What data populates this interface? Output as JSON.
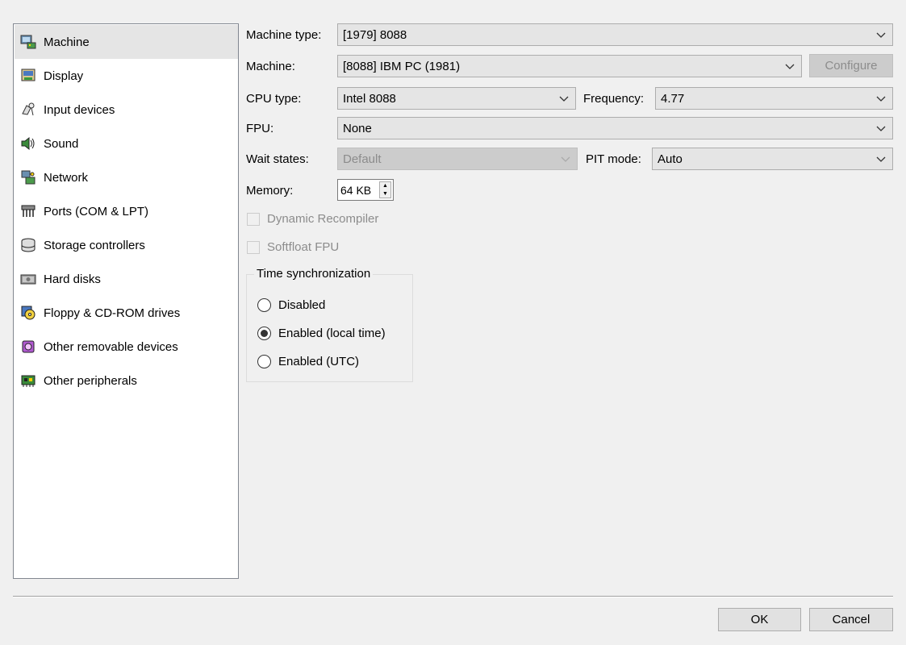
{
  "sidebar": {
    "selected_index": 0,
    "items": [
      {
        "label": "Machine",
        "icon": "machine-icon"
      },
      {
        "label": "Display",
        "icon": "display-icon"
      },
      {
        "label": "Input devices",
        "icon": "input-devices-icon"
      },
      {
        "label": "Sound",
        "icon": "sound-icon"
      },
      {
        "label": "Network",
        "icon": "network-icon"
      },
      {
        "label": "Ports (COM & LPT)",
        "icon": "ports-icon"
      },
      {
        "label": "Storage controllers",
        "icon": "storage-controllers-icon"
      },
      {
        "label": "Hard disks",
        "icon": "hard-disk-icon"
      },
      {
        "label": "Floppy & CD-ROM drives",
        "icon": "floppy-cdrom-icon"
      },
      {
        "label": "Other removable devices",
        "icon": "removable-devices-icon"
      },
      {
        "label": "Other peripherals",
        "icon": "peripherals-icon"
      }
    ]
  },
  "form": {
    "machine_type": {
      "label": "Machine type:",
      "value": "[1979] 8088"
    },
    "machine": {
      "label": "Machine:",
      "value": "[8088] IBM PC (1981)"
    },
    "configure_label": "Configure",
    "cpu_type": {
      "label": "CPU type:",
      "value": "Intel 8088"
    },
    "frequency": {
      "label": "Frequency:",
      "value": "4.77"
    },
    "fpu": {
      "label": "FPU:",
      "value": "None"
    },
    "wait_states": {
      "label": "Wait states:",
      "value": "Default"
    },
    "pit_mode": {
      "label": "PIT mode:",
      "value": "Auto"
    },
    "memory": {
      "label": "Memory:",
      "value": "64 KB"
    },
    "dynamic_recompiler": {
      "label": "Dynamic Recompiler",
      "checked": false,
      "enabled": false
    },
    "softfloat_fpu": {
      "label": "Softfloat FPU",
      "checked": false,
      "enabled": false
    }
  },
  "time_sync": {
    "title": "Time synchronization",
    "options": [
      {
        "label": "Disabled",
        "selected": false
      },
      {
        "label": "Enabled (local time)",
        "selected": true
      },
      {
        "label": "Enabled (UTC)",
        "selected": false
      }
    ]
  },
  "buttons": {
    "ok_label": "OK",
    "cancel_label": "Cancel"
  },
  "colors": {
    "window_bg": "#f0f0f0",
    "selected_item": "#e5e5e5",
    "disabled_text": "#8c8c8c"
  }
}
